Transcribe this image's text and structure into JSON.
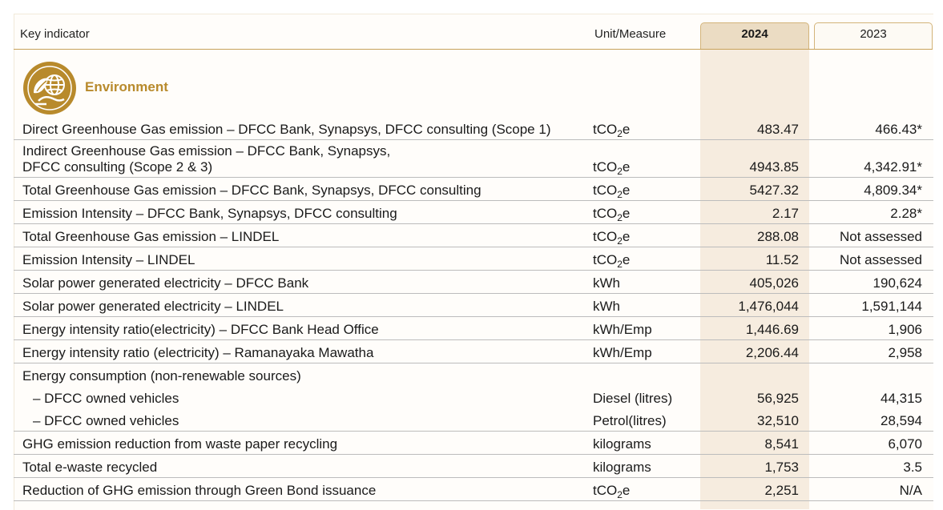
{
  "header": {
    "indicator": "Key indicator",
    "unit": "Unit/Measure",
    "year_current": "2024",
    "year_previous": "2023"
  },
  "section": {
    "title": "Environment",
    "icon": "leaf-globe-icon",
    "accent_color": "#b88a2c"
  },
  "rows": [
    {
      "indicator": "Direct Greenhouse Gas emission – DFCC Bank, Synapsys, DFCC consulting (Scope 1)",
      "unit": "tCO2e",
      "v2024": "483.47",
      "v2023": "466.43*"
    },
    {
      "indicator": "Indirect Greenhouse Gas emission – DFCC Bank, Synapsys,\nDFCC consulting (Scope 2 & 3)",
      "unit": "tCO2e",
      "v2024": "4943.85",
      "v2023": "4,342.91*"
    },
    {
      "indicator": "Total Greenhouse Gas emission – DFCC Bank, Synapsys, DFCC consulting",
      "unit": "tCO2e",
      "v2024": "5427.32",
      "v2023": "4,809.34*"
    },
    {
      "indicator": "Emission Intensity – DFCC Bank, Synapsys, DFCC consulting",
      "unit": "tCO2e",
      "v2024": "2.17",
      "v2023": "2.28*"
    },
    {
      "indicator": "Total Greenhouse Gas emission – LINDEL",
      "unit": "tCO2e",
      "v2024": "288.08",
      "v2023": "Not assessed"
    },
    {
      "indicator": "Emission Intensity – LINDEL",
      "unit": "tCO2e",
      "v2024": "11.52",
      "v2023": "Not assessed"
    },
    {
      "indicator": "Solar power generated electricity – DFCC Bank",
      "unit": "kWh",
      "v2024": "405,026",
      "v2023": "190,624"
    },
    {
      "indicator": "Solar power generated electricity – LINDEL",
      "unit": "kWh",
      "v2024": "1,476,044",
      "v2023": "1,591,144"
    },
    {
      "indicator": "Energy intensity ratio(electricity) – DFCC Bank Head Office",
      "unit": "kWh/Emp",
      "v2024": "1,446.69",
      "v2023": "1,906"
    },
    {
      "indicator": "Energy intensity ratio (electricity) – Ramanayaka Mawatha",
      "unit": "kWh/Emp",
      "v2024": "2,206.44",
      "v2023": "2,958"
    },
    {
      "indicator": "Energy consumption (non-renewable sources)",
      "unit": "",
      "v2024": "",
      "v2023": ""
    },
    {
      "indicator": "– DFCC owned vehicles",
      "unit": "Diesel (litres)",
      "v2024": "56,925",
      "v2023": "44,315"
    },
    {
      "indicator": "– DFCC owned vehicles",
      "unit": "Petrol(litres)",
      "v2024": "32,510",
      "v2023": "28,594"
    },
    {
      "indicator": "GHG emission reduction from waste paper recycling",
      "unit": "kilograms",
      "v2024": "8,541",
      "v2023": "6,070"
    },
    {
      "indicator": "Total e-waste recycled",
      "unit": "kilograms",
      "v2024": "1,753",
      "v2023": "3.5"
    },
    {
      "indicator": "Reduction of GHG emission through Green Bond issuance",
      "unit": "tCO2e",
      "v2024": "2,251",
      "v2023": "N/A"
    }
  ]
}
